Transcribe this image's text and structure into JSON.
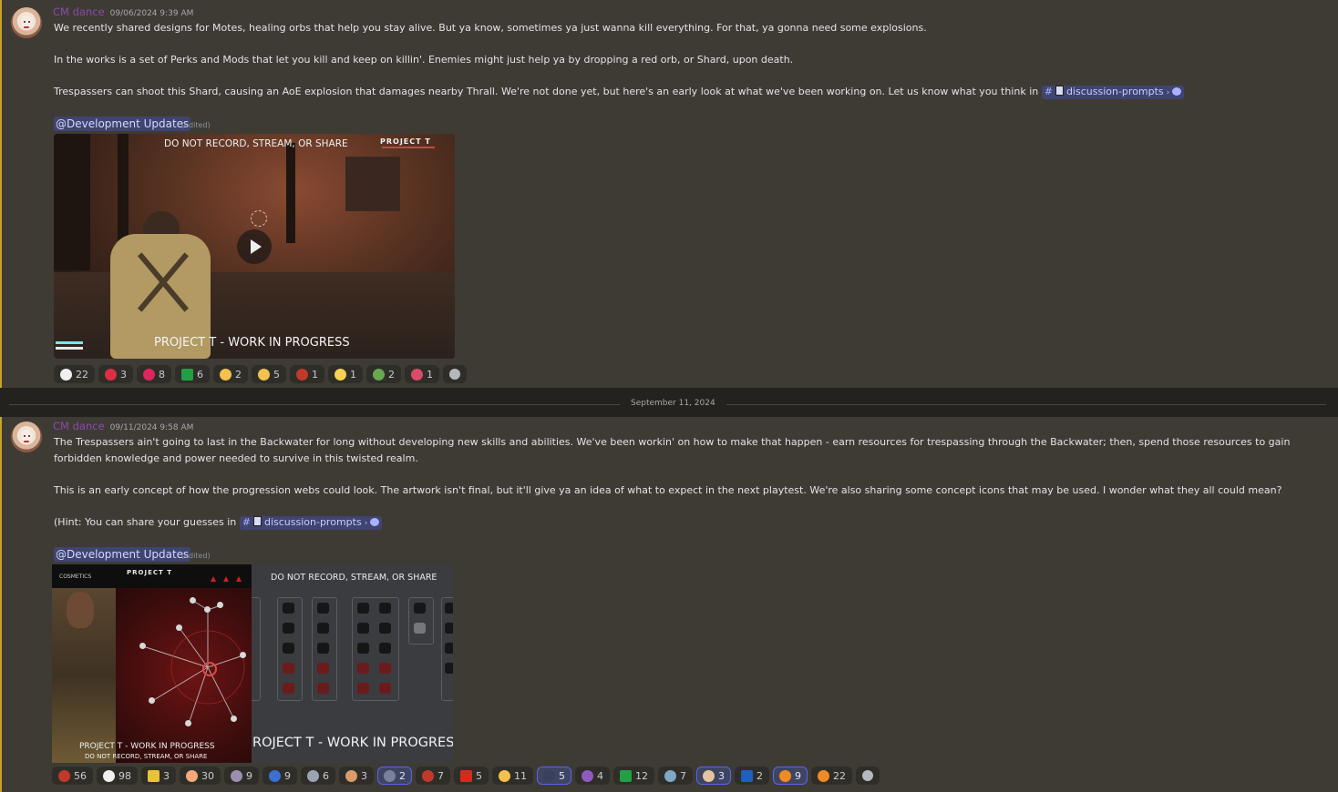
{
  "messages": [
    {
      "author": "CM dance",
      "timestamp": "09/06/2024 9:39 AM",
      "paragraphs": [
        "We recently shared designs for Motes, healing orbs that help you stay alive. But ya know, sometimes ya just wanna kill everything. For that, ya gonna need some explosions.",
        "In the works is a set of Perks and Mods that let you kill and keep on killin'. Enemies might just help ya by dropping a red orb, or Shard, upon death.",
        "Trespassers can shoot this Shard, causing an AoE explosion that damages nearby Thrall. We're not done yet, but here's an early look at what we've been working on. Let us know what you think in"
      ],
      "channel": "discussion-prompts",
      "mention": "@Development Updates",
      "edited": "(edited)",
      "video": {
        "top_text": "DO NOT RECORD, STREAM, OR SHARE",
        "logo": "PROJECT T",
        "bottom_text": "PROJECT T - WORK IN PROGRESS"
      },
      "reactions": [
        {
          "icon": "eyes-emoji",
          "count": "22",
          "color": "#f0f0f0"
        },
        {
          "icon": "red-circle-emoji",
          "count": "3",
          "color": "#dd2e44"
        },
        {
          "icon": "heart-emoji",
          "count": "8",
          "color": "#e0245e"
        },
        {
          "icon": "flag-brazil-emoji",
          "count": "6",
          "color": "#229e45"
        },
        {
          "icon": "pointing-hand-emoji",
          "count": "2",
          "color": "#f4c04e"
        },
        {
          "icon": "ok-hand-emoji",
          "count": "5",
          "color": "#f4c04e"
        },
        {
          "icon": "shattered-heart-emoji",
          "count": "1",
          "color": "#c0392b"
        },
        {
          "icon": "sparkles-emoji",
          "count": "1",
          "color": "#f7d154"
        },
        {
          "icon": "figure-emoji",
          "count": "2",
          "color": "#6aa84f"
        },
        {
          "icon": "lips-emoji",
          "count": "1",
          "color": "#d94c6a"
        }
      ]
    },
    {
      "author": "CM dance",
      "timestamp": "09/11/2024 9:58 AM",
      "paragraphs": [
        "The Trespassers ain't going to last in the Backwater for long without developing new skills and abilities. We've been workin' on how to make that happen  - earn resources for trespassing through the Backwater; then, spend those resources to gain",
        "forbidden knowledge and power needed to survive in this twisted realm.",
        "This is an early concept of how the progression webs could look. The artwork isn't final, but it'll give ya an idea of what to expect in the next playtest. We're also sharing some concept icons that may be used. I wonder what they all could mean?",
        "(Hint: You can share your guesses in"
      ],
      "channel": "discussion-prompts",
      "mention": "@Development Updates",
      "edited": "(edited)",
      "image_left": {
        "cosmetics": "COSMETICS",
        "logo": "PROJECT T",
        "caption1": "PROJECT T - WORK IN PROGRESS",
        "caption2": "DO NOT RECORD, STREAM, OR SHARE"
      },
      "image_right": {
        "top_text": "DO NOT RECORD, STREAM, OR SHARE",
        "bottom_text": "ROJECT T - WORK IN PROGRES"
      },
      "reactions": [
        {
          "icon": "creature-emoji",
          "count": "56",
          "color": "#c0392b",
          "active": false
        },
        {
          "icon": "eyes-emoji",
          "count": "98",
          "color": "#f0f0f0",
          "active": false
        },
        {
          "icon": "flag-emoji",
          "count": "3",
          "color": "#e8c33a",
          "active": false
        },
        {
          "icon": "hand-emoji",
          "count": "30",
          "color": "#f4a97a",
          "active": false
        },
        {
          "icon": "dancer-emoji",
          "count": "9",
          "color": "#9a8fb0",
          "active": false
        },
        {
          "icon": "blue-figure-emoji",
          "count": "9",
          "color": "#3b6fd1",
          "active": false
        },
        {
          "icon": "elephant-emoji",
          "count": "6",
          "color": "#9aa3b0",
          "active": false
        },
        {
          "icon": "box-emoji",
          "count": "3",
          "color": "#d99a6c",
          "active": false
        },
        {
          "icon": "robot-emoji",
          "count": "2",
          "color": "#7a7f9a",
          "active": true
        },
        {
          "icon": "red-creature-emoji",
          "count": "7",
          "color": "#c0392b",
          "active": false
        },
        {
          "icon": "flag-canada-emoji",
          "count": "5",
          "color": "#d52b1e",
          "active": false
        },
        {
          "icon": "astonished-emoji",
          "count": "11",
          "color": "#f4c04e",
          "active": false
        },
        {
          "icon": "dark-figure-emoji",
          "count": "5",
          "color": "#3a3f5c",
          "active": true
        },
        {
          "icon": "purple-creature-emoji",
          "count": "4",
          "color": "#8e5bbf",
          "active": false
        },
        {
          "icon": "flag-brazil-emoji",
          "count": "12",
          "color": "#229e45",
          "active": false
        },
        {
          "icon": "atom-emoji",
          "count": "7",
          "color": "#7fa7c7",
          "active": false
        },
        {
          "icon": "pray-emoji",
          "count": "3",
          "color": "#e6c2a0",
          "active": true
        },
        {
          "icon": "flag-scotland-emoji",
          "count": "2",
          "color": "#1f5fbf",
          "active": false
        },
        {
          "icon": "fire-hand-emoji",
          "count": "9",
          "color": "#f08a24",
          "active": true
        },
        {
          "icon": "fire-emoji",
          "count": "22",
          "color": "#f08a24",
          "active": false
        }
      ]
    }
  ],
  "date_divider": "September 11, 2024"
}
